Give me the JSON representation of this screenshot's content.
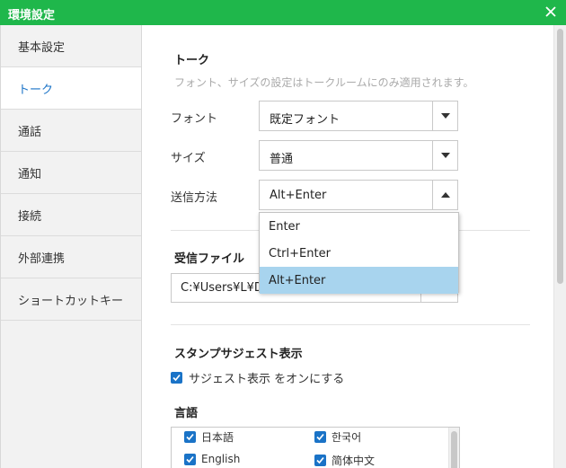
{
  "window": {
    "title": "環境設定",
    "accent_color": "#1fb74b"
  },
  "sidebar": {
    "items": [
      {
        "label": "基本設定"
      },
      {
        "label": "トーク",
        "active": true
      },
      {
        "label": "通話"
      },
      {
        "label": "通知"
      },
      {
        "label": "接続"
      },
      {
        "label": "外部連携"
      },
      {
        "label": "ショートカットキー"
      }
    ]
  },
  "talk": {
    "title": "トーク",
    "description": "フォント、サイズの設定はトークルームにのみ適用されます。",
    "font": {
      "label": "フォント",
      "value": "既定フォント"
    },
    "size": {
      "label": "サイズ",
      "value": "普通"
    },
    "send": {
      "label": "送信方法",
      "value": "Alt+Enter",
      "options": [
        "Enter",
        "Ctrl+Enter",
        "Alt+Enter"
      ],
      "selected_index": 2
    }
  },
  "received_files": {
    "title": "受信ファイル",
    "path": "C:¥Users¥L¥Do"
  },
  "stamp_suggest": {
    "title": "スタンプサジェスト表示",
    "checkbox_label": "サジェスト表示 をオンにする",
    "checked": true,
    "language_title": "言語",
    "languages": [
      {
        "label": "日本語",
        "checked": true
      },
      {
        "label": "한국어",
        "checked": true
      },
      {
        "label": "English",
        "checked": true
      },
      {
        "label": "简体中文",
        "checked": true
      }
    ]
  }
}
